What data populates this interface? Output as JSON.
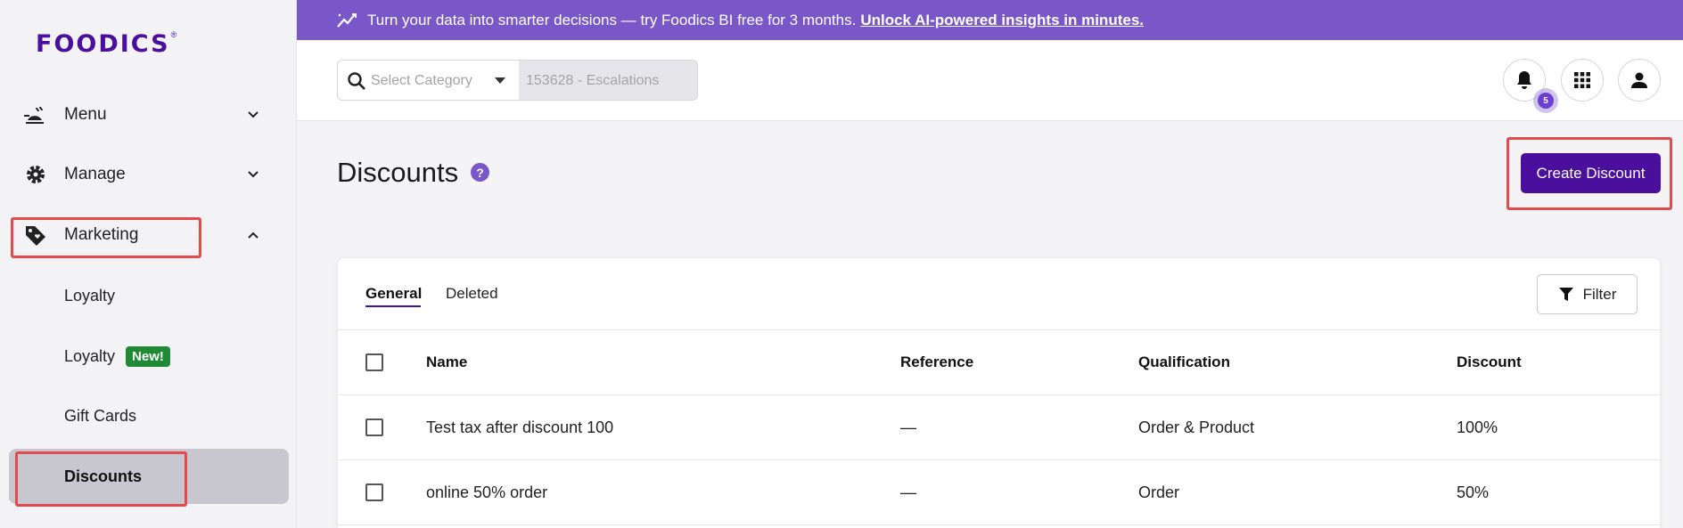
{
  "brand": {
    "name": "FOODICS",
    "reg": "®"
  },
  "banner": {
    "text": "Turn your data into smarter decisions — try Foodics BI free for 3 months.",
    "link": "Unlock AI-powered insights in minutes."
  },
  "sidebar": {
    "items": [
      {
        "label": "Menu",
        "icon": "food-tray-icon"
      },
      {
        "label": "Manage",
        "icon": "gear-icon"
      },
      {
        "label": "Marketing",
        "icon": "tag-heart-icon"
      }
    ],
    "subitems": [
      {
        "label": "Loyalty"
      },
      {
        "label": "Loyalty",
        "badge": "New!"
      },
      {
        "label": "Gift Cards"
      },
      {
        "label": "Discounts"
      }
    ]
  },
  "header": {
    "category_placeholder": "Select Category",
    "branch": "153628 - Escalations",
    "notification_count": "5"
  },
  "page": {
    "title": "Discounts",
    "help": "?",
    "create_label": "Create Discount"
  },
  "tabs": [
    {
      "label": "General"
    },
    {
      "label": "Deleted"
    }
  ],
  "filter_label": "Filter",
  "table": {
    "columns": [
      "Name",
      "Reference",
      "Qualification",
      "Discount"
    ],
    "rows": [
      [
        "Test tax after discount 100",
        "—",
        "Order & Product",
        "100%"
      ],
      [
        "online 50% order",
        "—",
        "Order",
        "50%"
      ]
    ]
  },
  "colors": {
    "brand": "#4a0f9c",
    "banner": "#7957c9",
    "highlight": "#e24a4f",
    "new_badge": "#1f8a34"
  }
}
